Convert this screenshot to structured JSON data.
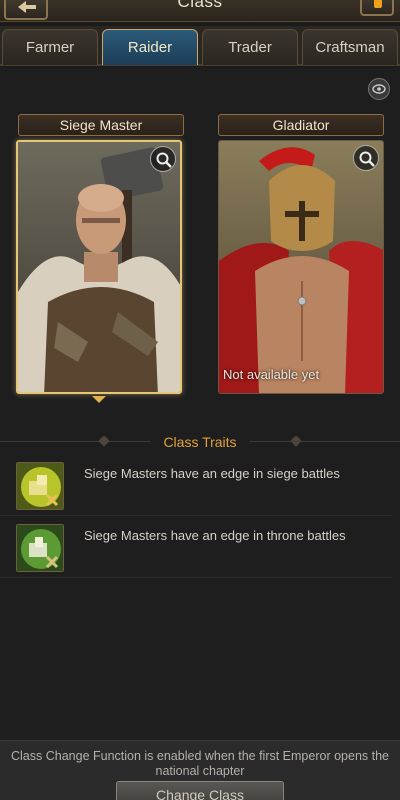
{
  "header": {
    "title": "Class"
  },
  "tabs": [
    {
      "label": "Farmer",
      "active": false
    },
    {
      "label": "Raider",
      "active": true
    },
    {
      "label": "Trader",
      "active": false
    },
    {
      "label": "Craftsman",
      "active": false
    }
  ],
  "classes": [
    {
      "name": "Siege Master",
      "selected": true,
      "status": ""
    },
    {
      "name": "Gladiator",
      "selected": false,
      "status": "Not available yet"
    }
  ],
  "traits": {
    "title": "Class Traits",
    "items": [
      {
        "text": "Siege Masters have an edge in siege battles",
        "icon": "siege-trait-icon"
      },
      {
        "text": "Siege Masters have an edge in throne battles",
        "icon": "throne-trait-icon"
      }
    ]
  },
  "footer": {
    "note": "Class Change Function is enabled when the first Emperor opens the national chapter",
    "button_label": "Change Class"
  },
  "colors": {
    "accent_gold": "#e7c773",
    "section_title": "#e3a13c",
    "active_tab": "#1c3d57"
  }
}
